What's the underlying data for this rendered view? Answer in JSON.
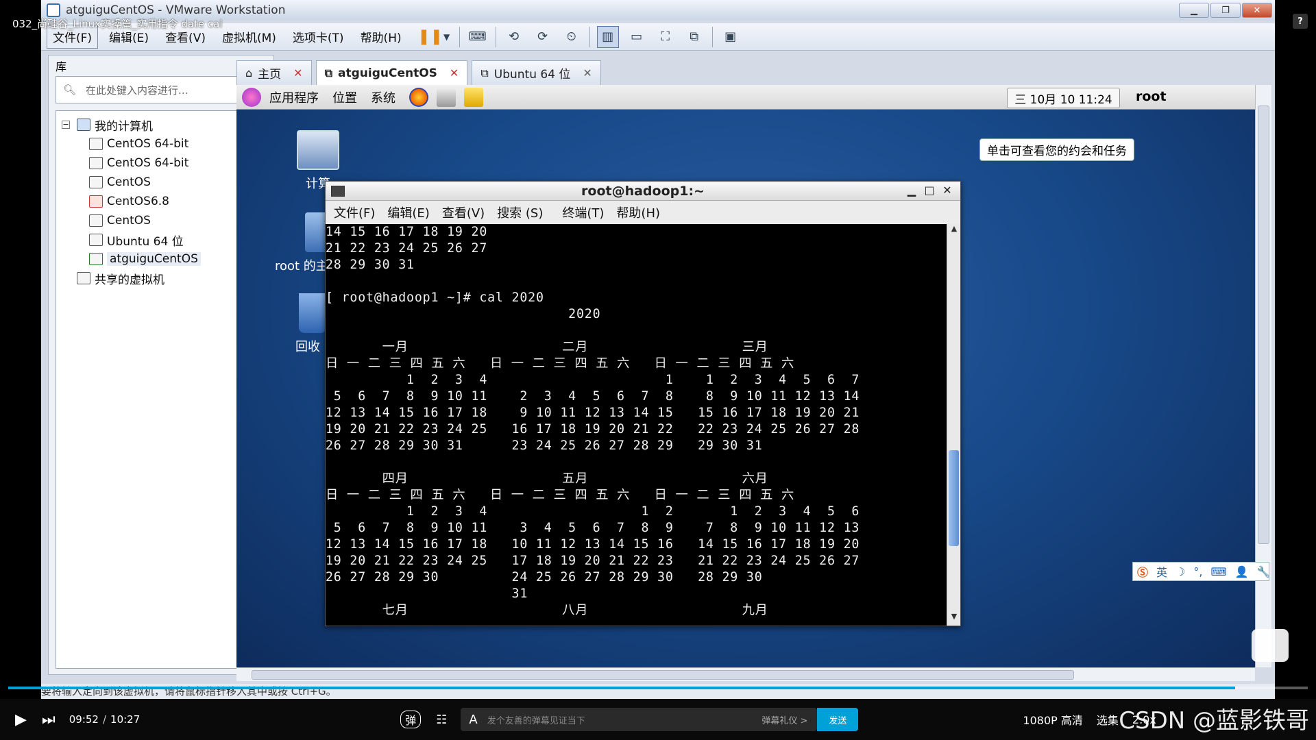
{
  "video": {
    "title": "032_尚硅谷_Linux实操篇_实用指令 date cal",
    "help_badge": "?"
  },
  "vmware": {
    "window_title": "atguiguCentOS - VMware Workstation",
    "menu": [
      "文件(F)",
      "编辑(E)",
      "查看(V)",
      "虚拟机(M)",
      "选项卡(T)",
      "帮助(H)"
    ],
    "status_text": "要将输入定向到该虚拟机，请将鼠标指针移入其中或按 Ctrl+G。",
    "library": {
      "title": "库",
      "search_placeholder": "在此处键入内容进行...",
      "tree": [
        {
          "label": "我的计算机",
          "level": 0,
          "type": "folder"
        },
        {
          "label": "CentOS 64-bit",
          "level": 1,
          "type": "vm"
        },
        {
          "label": "CentOS 64-bit",
          "level": 1,
          "type": "vm"
        },
        {
          "label": "CentOS",
          "level": 1,
          "type": "vm"
        },
        {
          "label": "CentOS6.8",
          "level": 1,
          "type": "vm-error"
        },
        {
          "label": "CentOS",
          "level": 1,
          "type": "vm"
        },
        {
          "label": "Ubuntu 64 位",
          "level": 1,
          "type": "vm"
        },
        {
          "label": "atguiguCentOS",
          "level": 1,
          "type": "vm-selected"
        },
        {
          "label": "共享的虚拟机",
          "level": 0,
          "type": "shared"
        }
      ]
    },
    "tabs": [
      {
        "label": "主页",
        "active": false
      },
      {
        "label": "atguiguCentOS",
        "active": true
      },
      {
        "label": "Ubuntu 64 位",
        "active": false
      }
    ]
  },
  "guest": {
    "panel_menus": [
      "应用程序",
      "位置",
      "系统"
    ],
    "clock": "三 10月 10 11:24",
    "user": "root",
    "tooltip": "单击可查看您的约会和任务",
    "desktop_icons": [
      {
        "label": "计算",
        "name": "computer"
      },
      {
        "label": "root 的主",
        "name": "home"
      },
      {
        "label": "回收",
        "name": "trash"
      }
    ],
    "ime": [
      "英",
      "☽",
      "°,",
      "⌨",
      "👤",
      "🔧"
    ]
  },
  "terminal": {
    "title": "root@hadoop1:~",
    "menu": [
      "文件(F)",
      "编辑(E)",
      "查看(V)",
      "搜索 (S)",
      "终端(T)",
      "帮助(H)"
    ],
    "lines": [
      "14 15 16 17 18 19 20",
      "21 22 23 24 25 26 27",
      "28 29 30 31",
      "",
      "[ root@hadoop1 ~]# cal 2020",
      "                              2020",
      "",
      "       一月                   二月                   三月",
      "日 一 二 三 四 五 六   日 一 二 三 四 五 六   日 一 二 三 四 五 六",
      "          1  2  3  4                      1    1  2  3  4  5  6  7",
      " 5  6  7  8  9 10 11    2  3  4  5  6  7  8    8  9 10 11 12 13 14",
      "12 13 14 15 16 17 18    9 10 11 12 13 14 15   15 16 17 18 19 20 21",
      "19 20 21 22 23 24 25   16 17 18 19 20 21 22   22 23 24 25 26 27 28",
      "26 27 28 29 30 31      23 24 25 26 27 28 29   29 30 31",
      "",
      "       四月                   五月                   六月",
      "日 一 二 三 四 五 六   日 一 二 三 四 五 六   日 一 二 三 四 五 六",
      "          1  2  3  4                   1  2       1  2  3  4  5  6",
      " 5  6  7  8  9 10 11    3  4  5  6  7  8  9    7  8  9 10 11 12 13",
      "12 13 14 15 16 17 18   10 11 12 13 14 15 16   14 15 16 17 18 19 20",
      "19 20 21 22 23 24 25   17 18 19 20 21 22 23   21 22 23 24 25 26 27",
      "26 27 28 29 30         24 25 26 27 28 29 30   28 29 30",
      "                       31",
      "       七月                   八月                   九月"
    ]
  },
  "player": {
    "time_current": "09:52",
    "time_total": "10:27",
    "progress": 0.944,
    "danmaku_placeholder": "发个友善的弹幕见证当下",
    "danmaku_etiquette": "弹幕礼仪 >",
    "send": "发送",
    "quality": "1080P 高清",
    "episodes": "选集",
    "speed": "2.0x",
    "watermark": "CSDN @蓝影铁哥"
  },
  "colors": {
    "accent": "#00a1d6",
    "desktop": "#184a8a",
    "terminal_bg": "#000000"
  }
}
